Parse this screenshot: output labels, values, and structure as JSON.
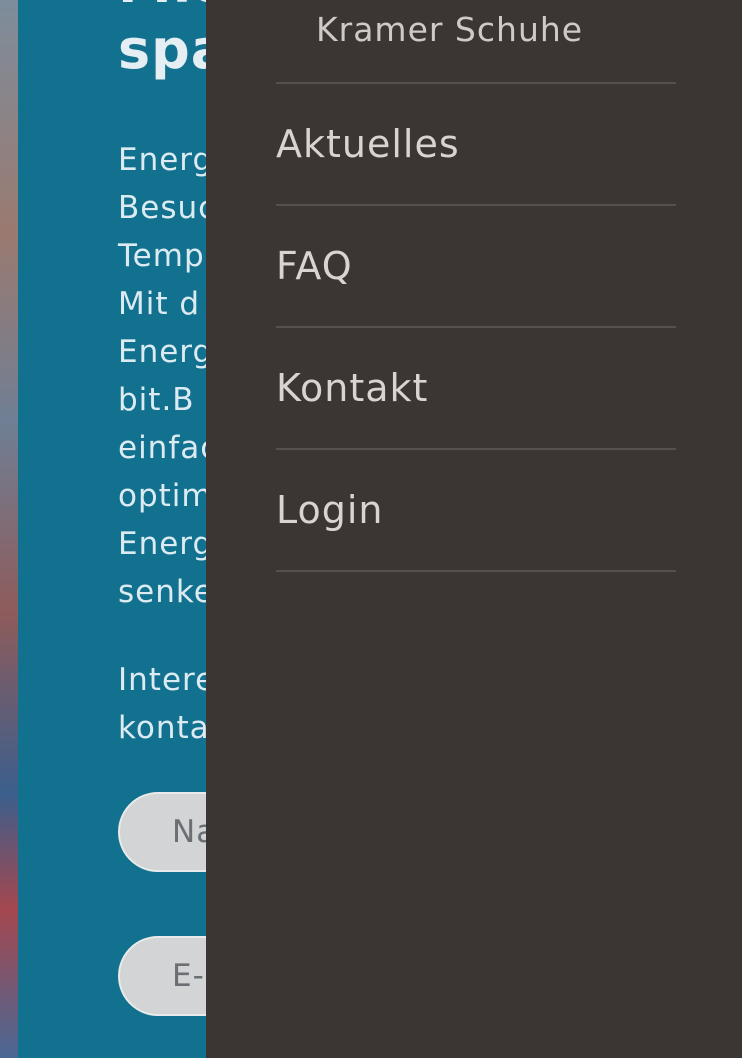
{
  "content": {
    "headline_top": "Mit",
    "headline": "spa",
    "body_lines": [
      "Energ",
      "Besuc",
      "Temp",
      "Mit d",
      "Energ",
      "bit.B",
      "einfac",
      "optim",
      "Energ",
      "senke"
    ],
    "interest_lines": [
      "Intere",
      "konta"
    ],
    "name_placeholder": "Na",
    "email_placeholder": "E-"
  },
  "menu": {
    "sub_item": "Kramer Schuhe",
    "items": [
      {
        "label": "Aktuelles"
      },
      {
        "label": "FAQ"
      },
      {
        "label": "Kontakt"
      },
      {
        "label": "Login"
      }
    ]
  },
  "colors": {
    "panel_blue": "#12718f",
    "menu_bg": "#3b3633",
    "divider": "#57514d"
  }
}
